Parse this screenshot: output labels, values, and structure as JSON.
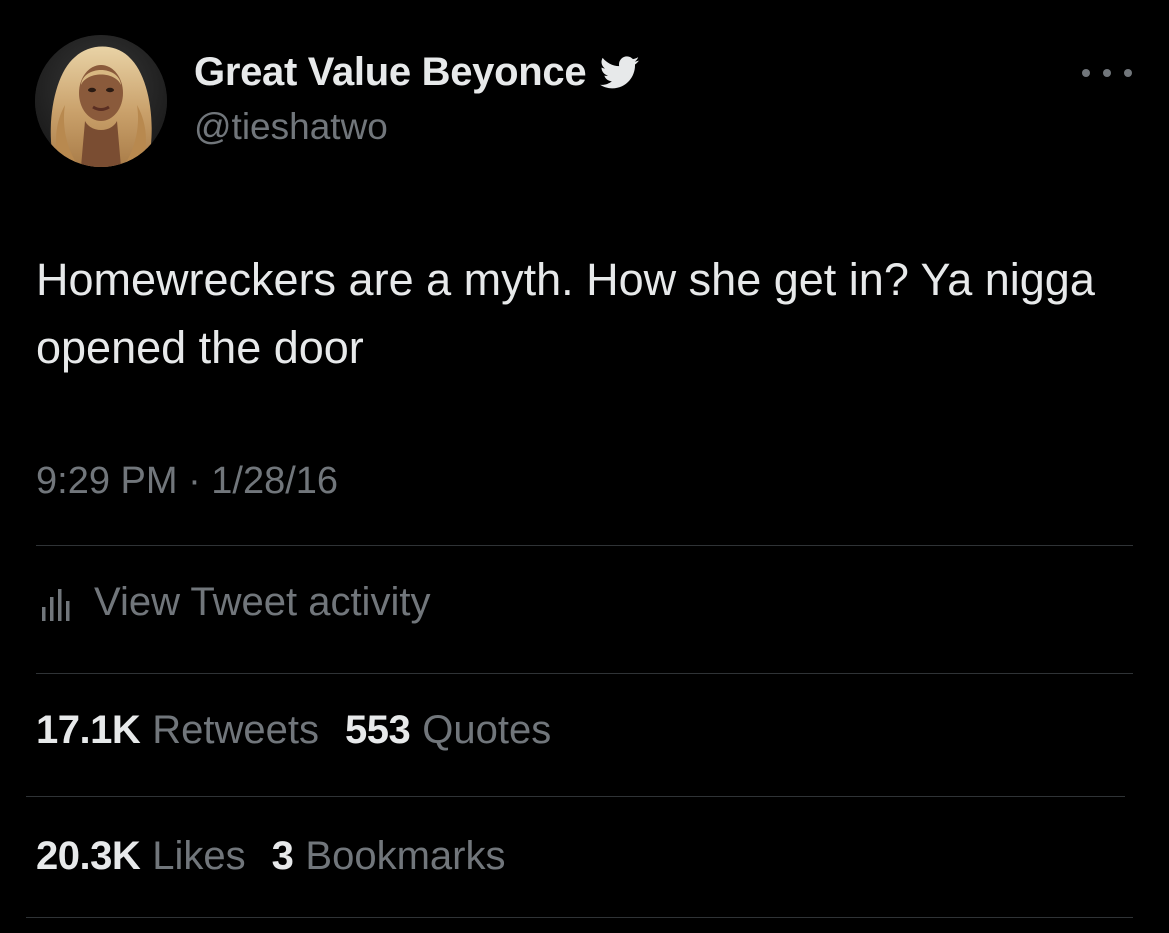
{
  "author": {
    "display_name": "Great Value Beyonce",
    "handle": "@tieshatwo",
    "avatar_icon": "profile-photo",
    "verified_icon": "twitter-bird-icon",
    "verified_color": "#e7e9ea"
  },
  "tweet": {
    "text": "Homewreckers are a myth. How she get in? Ya nigga opened the door",
    "timestamp": "9:29 PM · 1/28/16"
  },
  "activity": {
    "icon": "bar-chart-icon",
    "label": "View Tweet activity"
  },
  "stats": {
    "retweets_count": "17.1K",
    "retweets_label": "Retweets",
    "quotes_count": "553",
    "quotes_label": "Quotes",
    "likes_count": "20.3K",
    "likes_label": "Likes",
    "bookmarks_count": "3",
    "bookmarks_label": "Bookmarks"
  },
  "colors": {
    "background": "#000000",
    "primary_text": "#e7e9ea",
    "secondary_text": "#71767b",
    "divider": "#2f3336"
  }
}
